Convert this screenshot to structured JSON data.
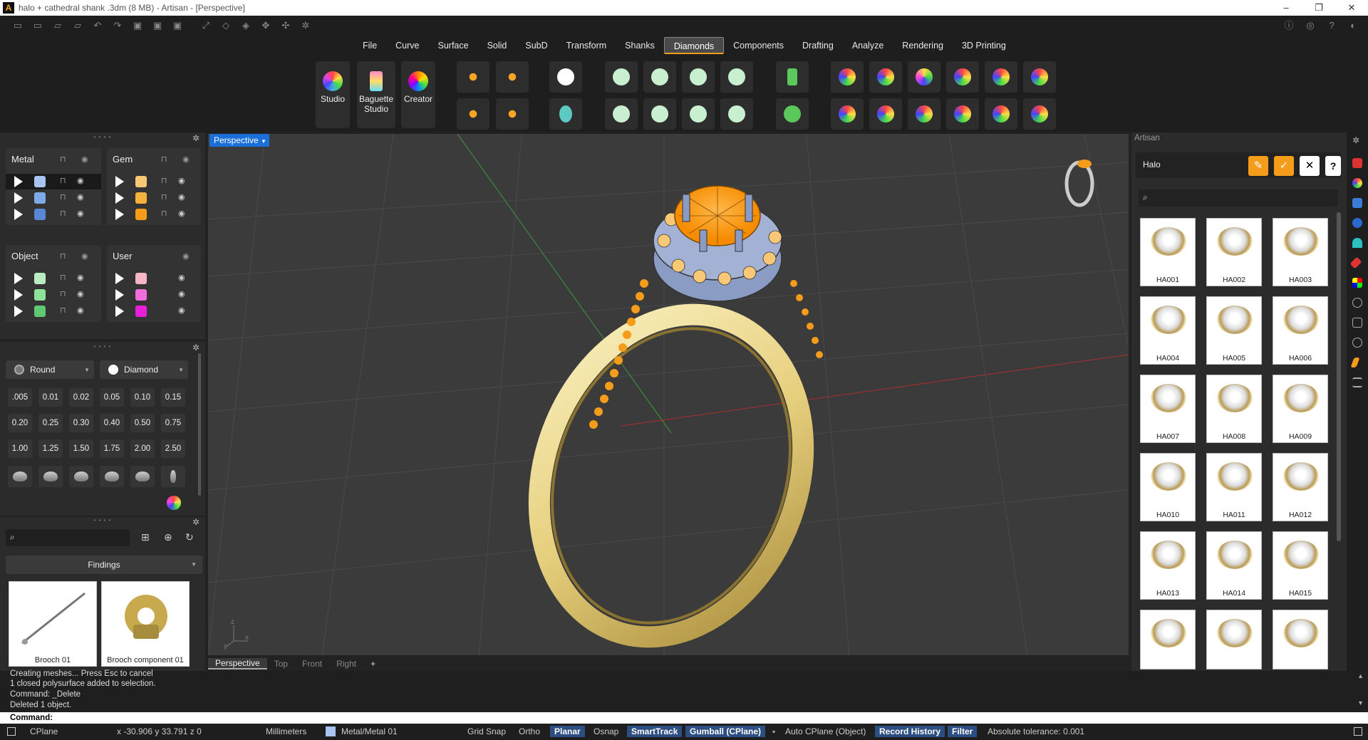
{
  "window": {
    "title": "halo + cathedral shank .3dm (8 MB) - Artisan - [Perspective]",
    "logo_letter": "A"
  },
  "menu": {
    "tabs": [
      "File",
      "Curve",
      "Surface",
      "Solid",
      "SubD",
      "Transform",
      "Shanks",
      "Diamonds",
      "Components",
      "Drafting",
      "Analyze",
      "Rendering",
      "3D Printing"
    ],
    "active": "Diamonds"
  },
  "toolbar": {
    "studio": "Studio",
    "baguette_line1": "Baguette",
    "baguette_line2": "Studio",
    "creator": "Creator"
  },
  "layers": {
    "metal": {
      "label": "Metal",
      "colors": [
        "#a8c4f0",
        "#7faae8",
        "#5a86d6"
      ]
    },
    "gem": {
      "label": "Gem",
      "colors": [
        "#f8c877",
        "#f6b23a",
        "#f59c1a"
      ]
    },
    "object": {
      "label": "Object",
      "colors": [
        "#b9ecc0",
        "#8fe29a",
        "#5ec873"
      ]
    },
    "user": {
      "label": "User",
      "colors": [
        "#f7b6c5",
        "#f06ddc",
        "#e81ed8"
      ]
    }
  },
  "gem_select": {
    "cut": "Round",
    "type": "Diamond"
  },
  "carats": [
    [
      ".005",
      "0.01",
      "0.02",
      "0.05",
      "0.10",
      "0.15"
    ],
    [
      "0.20",
      "0.25",
      "0.30",
      "0.40",
      "0.50",
      "0.75"
    ],
    [
      "1.00",
      "1.25",
      "1.50",
      "1.75",
      "2.00",
      "2.50"
    ]
  ],
  "library": {
    "category": "Findings",
    "items": [
      "Brooch 01",
      "Brooch component 01"
    ]
  },
  "viewport": {
    "name": "Perspective",
    "tabs": [
      "Perspective",
      "Top",
      "Front",
      "Right"
    ],
    "add": "+",
    "axis_x": "x",
    "axis_y": "y",
    "axis_z": "z"
  },
  "artisan_panel": {
    "title": "Artisan",
    "category": "Halo",
    "items": [
      "HA001",
      "HA002",
      "HA003",
      "HA004",
      "HA005",
      "HA006",
      "HA007",
      "HA008",
      "HA009",
      "HA010",
      "HA011",
      "HA012",
      "HA013",
      "HA014",
      "HA015",
      "",
      "",
      ""
    ]
  },
  "command_history": [
    "Creating meshes... Press Esc to cancel",
    "1 closed polysurface added to selection.",
    "Command: _Delete",
    "Deleted 1 object."
  ],
  "command_prompt": "Command:",
  "status": {
    "cplane": "CPlane",
    "coords": "x -30.906  y 33.791  z 0",
    "units": "Millimeters",
    "layer": "Metal/Metal 01",
    "grid_snap": "Grid Snap",
    "ortho": "Ortho",
    "planar": "Planar",
    "osnap": "Osnap",
    "smarttrack": "SmartTrack",
    "gumball": "Gumball (CPlane)",
    "auto_cplane": "Auto CPlane (Object)",
    "record_history": "Record History",
    "filter": "Filter",
    "tolerance": "Absolute tolerance: 0.001"
  },
  "colors": {
    "accent": "#f59c1a",
    "viewport_tab": "#1a6fd8",
    "metal": "#f4e5a4",
    "gem": "#f59c1a",
    "prongs": "#8a9bc4"
  }
}
